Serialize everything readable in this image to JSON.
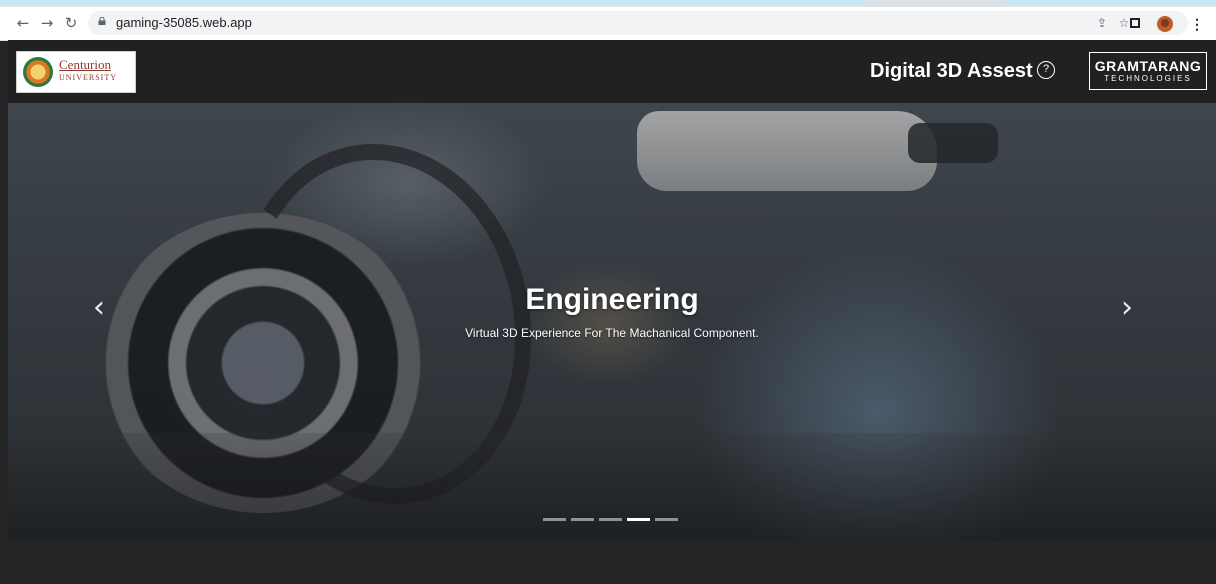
{
  "browser": {
    "url": "gaming-35085.web.app",
    "icons": [
      "back-icon",
      "forward-icon",
      "reload-icon",
      "lock-icon",
      "share-icon",
      "bookmark-star-icon",
      "side-panel-icon",
      "profile-avatar",
      "menu-kebab-icon"
    ]
  },
  "header": {
    "left_logo": {
      "line1": "Centurion",
      "line2": "UNIVERSITY"
    },
    "title": "Digital 3D Assest",
    "help_glyph": "?",
    "right_logo": {
      "line1": "GRAMTARANG",
      "line2": "TECHNOLOGIES"
    }
  },
  "carousel": {
    "title": "Engineering",
    "subtitle": "Virtual 3D Experience For The Machanical Component.",
    "prev_glyph": "‹",
    "next_glyph": "›",
    "slide_count": 5,
    "active_index": 3
  }
}
